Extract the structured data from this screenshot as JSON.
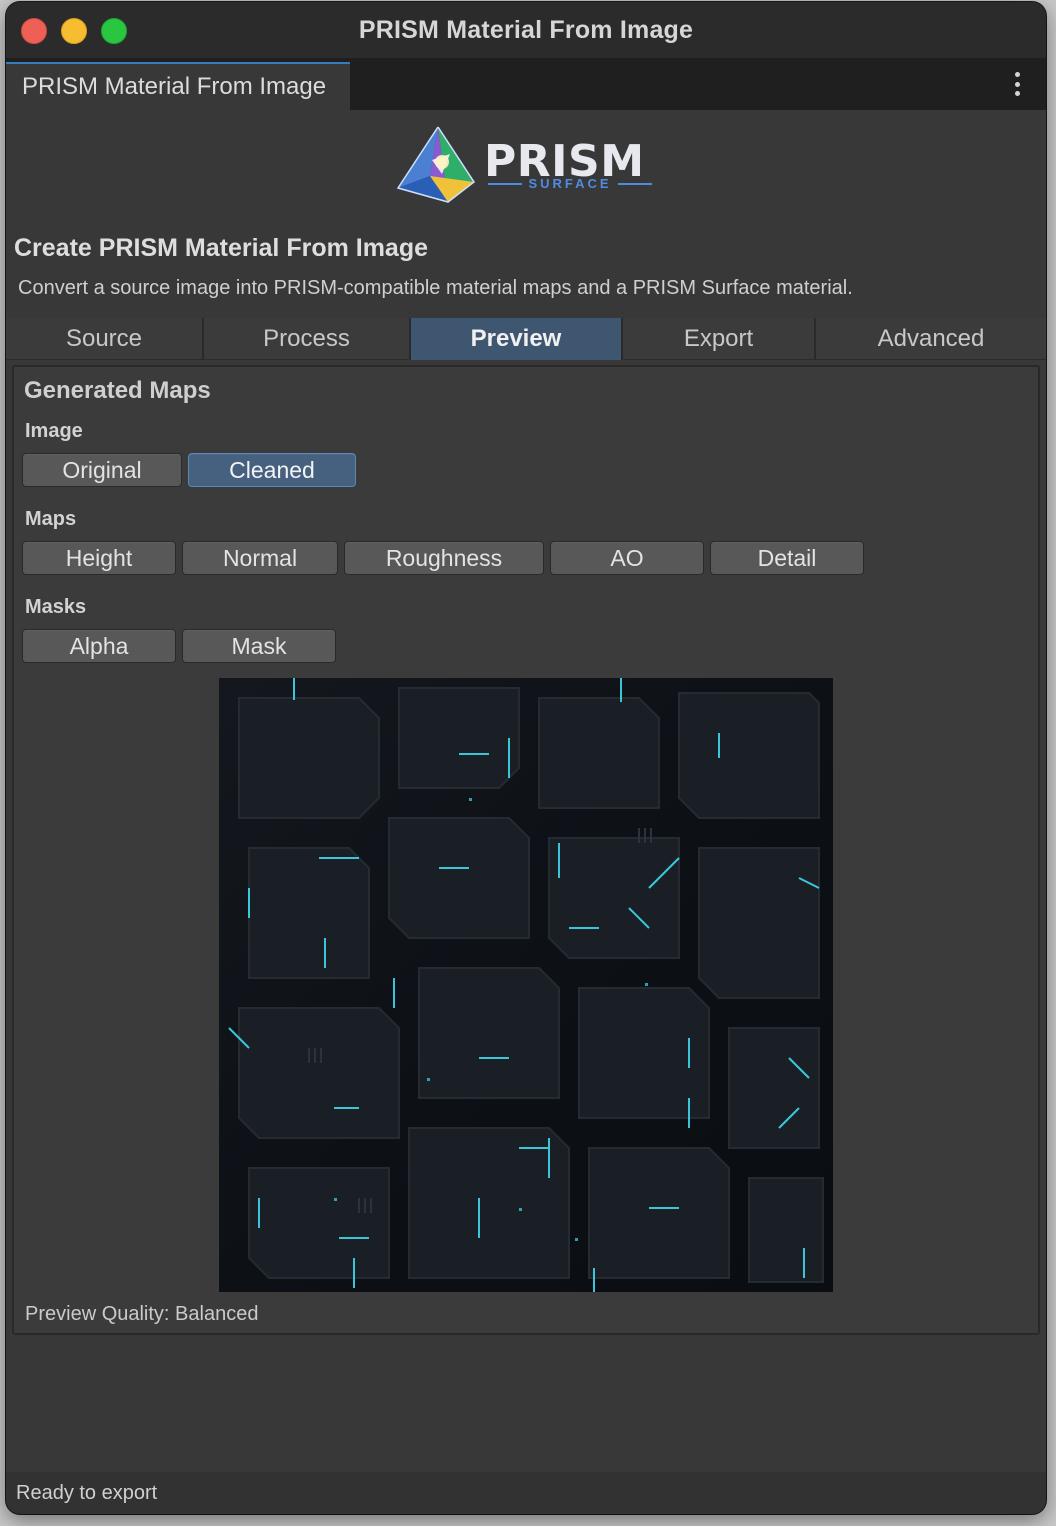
{
  "window": {
    "title": "PRISM Material From Image"
  },
  "doc_tab": {
    "label": "PRISM Material From Image"
  },
  "logo": {
    "word": "PRISM",
    "sub": "SURFACE"
  },
  "header": {
    "title": "Create PRISM Material From Image",
    "description": "Convert a source image into PRISM-compatible material maps and a PRISM Surface material."
  },
  "tabs": [
    {
      "label": "Source",
      "active": false
    },
    {
      "label": "Process",
      "active": false
    },
    {
      "label": "Preview",
      "active": true
    },
    {
      "label": "Export",
      "active": false
    },
    {
      "label": "Advanced",
      "active": false
    }
  ],
  "panel": {
    "title": "Generated Maps",
    "image_group": {
      "label": "Image",
      "buttons": [
        "Original",
        "Cleaned"
      ],
      "selected": "Cleaned"
    },
    "maps_group": {
      "label": "Maps",
      "buttons": [
        "Height",
        "Normal",
        "Roughness",
        "AO",
        "Detail"
      ]
    },
    "masks_group": {
      "label": "Masks",
      "buttons": [
        "Alpha",
        "Mask"
      ]
    },
    "preview_quality": "Preview Quality: Balanced"
  },
  "status": {
    "text": "Ready to export"
  },
  "colors": {
    "accent": "#3e5670",
    "glow": "#3fd8ee",
    "background": "#383838"
  }
}
